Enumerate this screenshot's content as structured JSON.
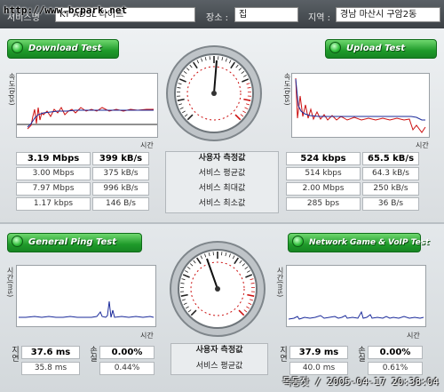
{
  "watermark": "http://www.bcpark.net",
  "topbar": {
    "service_label": "서비스명",
    "service_value": "KT ADSL 라이트",
    "place_label": "장소 :",
    "place_value": "집",
    "region_label": "지역 :",
    "region_value": "경남 마산시 구암2동"
  },
  "speed": {
    "download_title": "Download Test",
    "upload_title": "Upload Test",
    "ylabel": "속도(bps)",
    "xlabel": "시간",
    "row_labels": [
      "사용자 측정값",
      "서비스 평균값",
      "서비스 최대값",
      "서비스 최소값"
    ],
    "download": [
      {
        "a": "3.19 Mbps",
        "b": "399 kB/s"
      },
      {
        "a": "3.00 Mbps",
        "b": "375 kB/s"
      },
      {
        "a": "7.97 Mbps",
        "b": "996 kB/s"
      },
      {
        "a": "1.17 kbps",
        "b": "146 B/s"
      }
    ],
    "upload": [
      {
        "a": "524 kbps",
        "b": "65.5 kB/s"
      },
      {
        "a": "514 kbps",
        "b": "64.3 kB/s"
      },
      {
        "a": "2.00 Mbps",
        "b": "250 kB/s"
      },
      {
        "a": "285 bps",
        "b": "36 B/s"
      }
    ]
  },
  "ping": {
    "ping_title": "General Ping Test",
    "game_title": "Network Game & VoIP Test",
    "ylabel": "시간(ms)",
    "xlabel": "시간",
    "delay_label": "지연",
    "loss_label": "손실",
    "row_labels": [
      "사용자 측정값",
      "서비스 평균값"
    ],
    "ping": [
      {
        "delay": "37.6 ms",
        "loss": "0.00%"
      },
      {
        "delay": "35.8 ms",
        "loss": "0.44%"
      }
    ],
    "game": [
      {
        "delay": "37.9 ms",
        "loss": "0.00%"
      },
      {
        "delay": "40.0 ms",
        "loss": "0.61%"
      }
    ]
  },
  "footer": "목동잣 / 2005-04-17 20:38:04",
  "colors": {
    "accent_green": "#1f9a2a",
    "series_red": "#cc1111",
    "series_blue": "#1a2a9a"
  }
}
